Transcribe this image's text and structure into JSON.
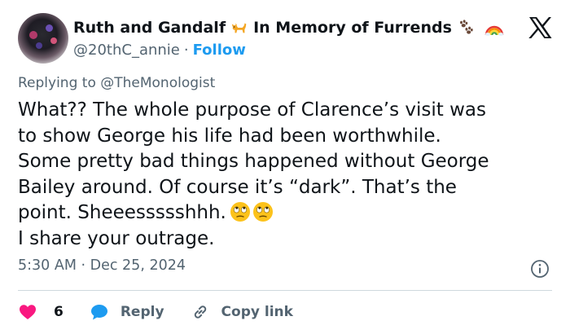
{
  "tweet": {
    "author": {
      "display_name_part1": "Ruth and Gandalf",
      "display_name_part2": "In Memory of Furrends",
      "handle": "@20thC_annie",
      "separator": "·",
      "follow_label": "Follow"
    },
    "replying_prefix": "Replying to",
    "replying_to": "@TheMonologist",
    "body_lines": [
      "What?? The whole purpose of Clarence’s visit was",
      "to show George his life had been worthwhile.",
      "Some pretty bad things happened without George",
      "Bailey around. Of course it’s “dark”. That’s the",
      "point. Sheeessssshhh.",
      "I share your outrage."
    ],
    "timestamp": "5:30 AM · Dec 25, 2024",
    "actions": {
      "like_count": "6",
      "reply_label": "Reply",
      "copy_link_label": "Copy link"
    },
    "colors": {
      "text": "#0f1419",
      "secondary": "#536471",
      "link": "#1d9bf0",
      "like": "#f91880",
      "divider": "#cfd9de"
    },
    "icons": [
      "cat-emoji-icon",
      "paw-prints-icon",
      "rainbow-icon",
      "x-logo-icon",
      "face-with-rolling-eyes-icon",
      "info-icon",
      "heart-icon",
      "reply-bubble-icon",
      "link-icon"
    ]
  }
}
